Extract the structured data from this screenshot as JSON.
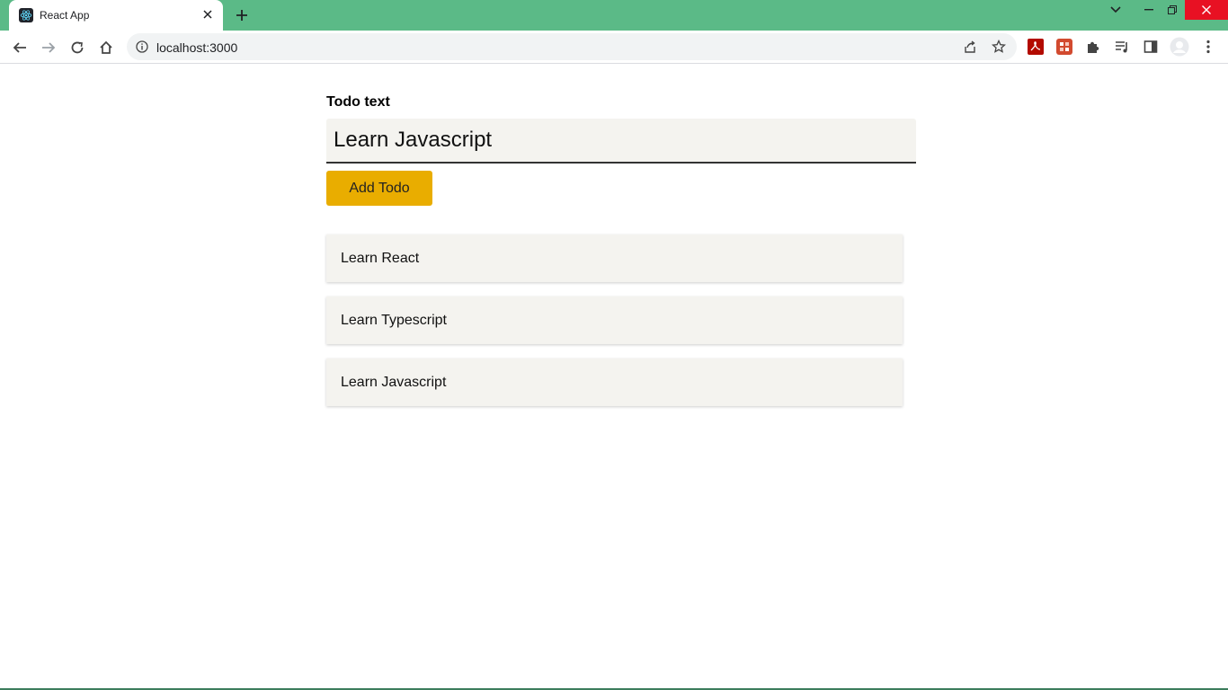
{
  "browser": {
    "tab_title": "React App",
    "url": "localhost:3000",
    "favicon": "react-logo-icon",
    "accent_color": "#5bba87"
  },
  "form": {
    "label": "Todo text",
    "input_value": "Learn Javascript",
    "button_label": "Add Todo",
    "button_color": "#e9ad00"
  },
  "todos": [
    {
      "text": "Learn React"
    },
    {
      "text": "Learn Typescript"
    },
    {
      "text": "Learn Javascript"
    }
  ]
}
